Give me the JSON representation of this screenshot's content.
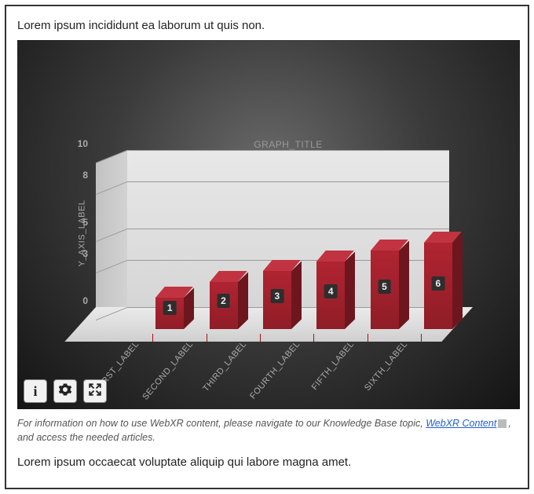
{
  "paragraphs": {
    "top": "Lorem ipsum incididunt ea laborum ut quis non.",
    "bottom": "Lorem ipsum occaecat voluptate aliquip qui labore magna amet."
  },
  "info": {
    "prefix": "For information on how to use WebXR content, please navigate to our Knowledge Base topic, ",
    "link_text": "WebXR Content",
    "suffix": ", and access the needed articles."
  },
  "controls": {
    "info_label": "i",
    "settings_label": "settings",
    "fullscreen_label": "fullscreen"
  },
  "chart_data": {
    "type": "bar",
    "title": "GRAPH_TITLE",
    "ylabel": "Y_AXIS_LABEL",
    "xlabel": "",
    "ylim": [
      0,
      10
    ],
    "yticks": [
      0,
      3,
      5,
      8,
      10
    ],
    "categories": [
      "FIRST_LABEL",
      "SECOND_LABEL",
      "THIRD_LABEL",
      "FOURTH_LABEL",
      "FIFTH_LABEL",
      "SIXTH_LABEL"
    ],
    "values": [
      2.0,
      3.0,
      3.7,
      4.3,
      5.0,
      5.5
    ],
    "bar_labels": [
      "1",
      "2",
      "3",
      "4",
      "5",
      "6"
    ],
    "colors": {
      "bar": "#a6212d",
      "bar_top": "#c13340",
      "bar_side": "#6e161e"
    }
  }
}
